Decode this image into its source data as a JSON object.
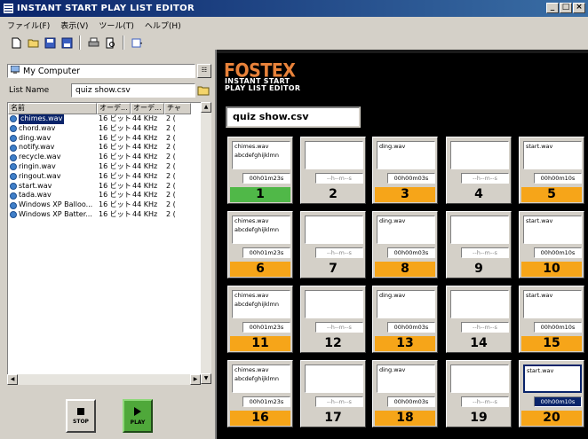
{
  "window": {
    "title": "INSTANT START PLAY LIST EDITOR",
    "btns": [
      "_",
      "□",
      "×"
    ]
  },
  "menu": [
    "ファイル(F)",
    "表示(V)",
    "ツール(T)",
    "ヘルプ(H)"
  ],
  "left": {
    "drive": "My Computer",
    "list_label": "List Name",
    "list_name": "quiz show.csv",
    "columns": [
      "名前",
      "オーデ...",
      "オーデ...",
      "チャ"
    ],
    "files": [
      {
        "name": "chimes.wav",
        "bits": "16 ビット",
        "rate": "44 KHz",
        "ch": "2 ("
      },
      {
        "name": "chord.wav",
        "bits": "16 ビット",
        "rate": "44 KHz",
        "ch": "2 ("
      },
      {
        "name": "ding.wav",
        "bits": "16 ビット",
        "rate": "44 KHz",
        "ch": "2 ("
      },
      {
        "name": "notify.wav",
        "bits": "16 ビット",
        "rate": "44 KHz",
        "ch": "2 ("
      },
      {
        "name": "recycle.wav",
        "bits": "16 ビット",
        "rate": "44 KHz",
        "ch": "2 ("
      },
      {
        "name": "ringin.wav",
        "bits": "16 ビット",
        "rate": "44 KHz",
        "ch": "2 ("
      },
      {
        "name": "ringout.wav",
        "bits": "16 ビット",
        "rate": "44 KHz",
        "ch": "2 ("
      },
      {
        "name": "start.wav",
        "bits": "16 ビット",
        "rate": "44 KHz",
        "ch": "2 ("
      },
      {
        "name": "tada.wav",
        "bits": "16 ビット",
        "rate": "44 KHz",
        "ch": "2 ("
      },
      {
        "name": "Windows XP Balloo...",
        "bits": "16 ビット",
        "rate": "44 KHz",
        "ch": "2 ("
      },
      {
        "name": "Windows XP Batter...",
        "bits": "16 ビット",
        "rate": "44 KHz",
        "ch": "2 ("
      }
    ],
    "stop_label": "STOP",
    "play_label": "PLAY"
  },
  "right": {
    "logo": "FOSTEX",
    "sub1": "INSTANT START",
    "sub2": "PLAY LIST EDITOR",
    "playlist_name": "quiz show.csv",
    "slots": [
      {
        "num": "1",
        "line1": "chimes.wav",
        "line2": "abcdefghijklmn",
        "time": "00h01m23s",
        "color": "green"
      },
      {
        "num": "2",
        "line1": "",
        "line2": "",
        "time": "--h--m--s",
        "color": "gray"
      },
      {
        "num": "3",
        "line1": "ding.wav",
        "line2": "",
        "time": "00h00m03s",
        "color": "orange"
      },
      {
        "num": "4",
        "line1": "",
        "line2": "",
        "time": "--h--m--s",
        "color": "gray"
      },
      {
        "num": "5",
        "line1": "start.wav",
        "line2": "",
        "time": "00h00m10s",
        "color": "orange"
      },
      {
        "num": "6",
        "line1": "chimes.wav",
        "line2": "abcdefghijklmn",
        "time": "00h01m23s",
        "color": "orange"
      },
      {
        "num": "7",
        "line1": "",
        "line2": "",
        "time": "--h--m--s",
        "color": "gray"
      },
      {
        "num": "8",
        "line1": "ding.wav",
        "line2": "",
        "time": "00h00m03s",
        "color": "orange"
      },
      {
        "num": "9",
        "line1": "",
        "line2": "",
        "time": "--h--m--s",
        "color": "gray"
      },
      {
        "num": "10",
        "line1": "start.wav",
        "line2": "",
        "time": "00h00m10s",
        "color": "orange"
      },
      {
        "num": "11",
        "line1": "chimes.wav",
        "line2": "abcdefghijklmn",
        "time": "00h01m23s",
        "color": "orange"
      },
      {
        "num": "12",
        "line1": "",
        "line2": "",
        "time": "--h--m--s",
        "color": "gray"
      },
      {
        "num": "13",
        "line1": "ding.wav",
        "line2": "",
        "time": "00h00m03s",
        "color": "orange"
      },
      {
        "num": "14",
        "line1": "",
        "line2": "",
        "time": "--h--m--s",
        "color": "gray"
      },
      {
        "num": "15",
        "line1": "start.wav",
        "line2": "",
        "time": "00h00m10s",
        "color": "orange"
      },
      {
        "num": "16",
        "line1": "chimes.wav",
        "line2": "abcdefghijklmn",
        "time": "00h01m23s",
        "color": "orange"
      },
      {
        "num": "17",
        "line1": "",
        "line2": "",
        "time": "--h--m--s",
        "color": "gray"
      },
      {
        "num": "18",
        "line1": "ding.wav",
        "line2": "",
        "time": "00h00m03s",
        "color": "orange"
      },
      {
        "num": "19",
        "line1": "",
        "line2": "",
        "time": "--h--m--s",
        "color": "gray"
      },
      {
        "num": "20",
        "line1": "start.wav",
        "line2": "",
        "time": "00h00m10s",
        "color": "orange"
      }
    ]
  }
}
